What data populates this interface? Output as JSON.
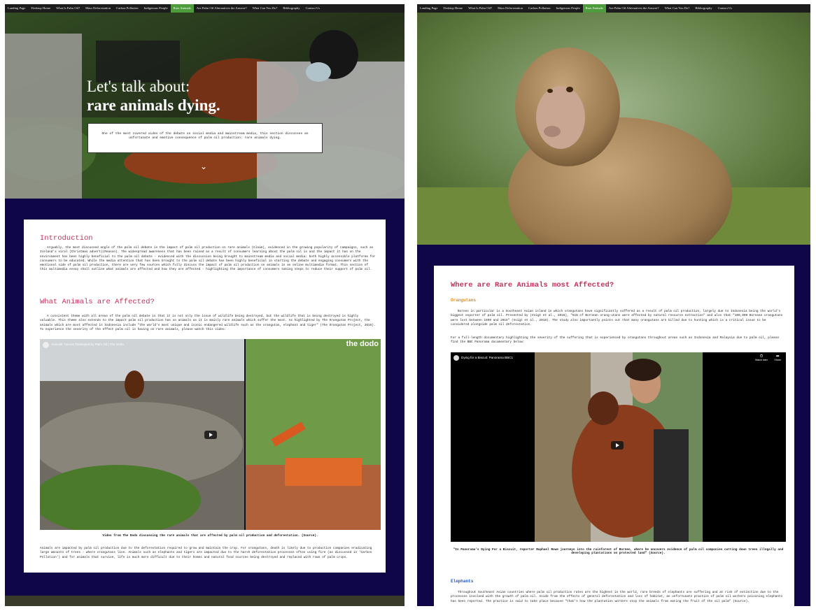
{
  "nav": {
    "items": [
      "Landing Page",
      "Desktop Home",
      "What Is Palm Oil?",
      "Mass Deforestation",
      "Carbon Pollution",
      "Indigenous People",
      "Rare Animals",
      "Are Palm Oil Alternatives the Answer?",
      "What Can You Do?",
      "Bibliography",
      "Contact Us"
    ],
    "active_index": 6
  },
  "left": {
    "hero_title_line1": "Let's talk about:",
    "hero_title_line2": "rare animals dying.",
    "hero_text": "One of the most covered sides of the debate on social media and mainstream media, this section discusses an unfortunate and emotive consequence of palm oil production: rare animals dying.",
    "intro_heading": "Introduction",
    "intro_text": "Arguably, the most discussed angle of the palm oil debate is the impact of palm oil production on rare animals (Glaim), evidenced in the growing popularity of campaigns, such as Iceland's viral (Christmas advert)(Reason). The widespread awareness that has been raised as a result of consumers learning about the palm oil is and the impact it has on the environment has been highly beneficial to the palm oil debate - evidenced with the discussion being brought to mainstream media and social media: both highly accessible platforms for consumers to be educated. While the media attention that has been brought to the palm oil debate has been highly beneficial in starting the debate and engaging consumers with the emotional side of palm oil production, there are very few sources which fully discuss the impact of palm oil production on animals in an online multimedia format. This section of this multimedia essay shall outline what animals are affected and how they are affected - highlighting the importance of consumers taking steps to reduce their support of palm oil.",
    "affected_heading": "What Animals are Affected?",
    "affected_text": "A consistent theme with all areas of the palm oil debate is that it is not only the issue of wildlife being destroyed, but the wildlife that is being destroyed is highly valuable. This theme also extends to the impact palm oil production has on animals as it is mainly rare animals which suffer the most. As highlighted by The Orangutan Project, the animals which are most affected in Indonesia include \"the world's most unique and iconic endangered wildlife such as the orangutan, elephant and tiger\" (The Orangutan Project, 2016). To experience the severity of the effect palm oil is having on rare animals, please watch this video:",
    "video_title": "Animals' Homes Destroyed by Palm Oil | The Dodo",
    "dodo_logo": "the dodo",
    "video_caption": "Video from The Dodo discussing the rare animals that are affected by palm oil production and deforestation. (Source).",
    "after_text": "Animals are impacted by palm oil production due to the deforestation required to grow and maintain the crop. For orangutans, death is likely due to production companies eradicating large amounts of trees - where orangutans live. Animals such as elephants and tigers are impacted due to the harsh deforestation processes often using fire (as discussed in 'Carbon Pollution') and for animals that survive, life is much more difficult due to their homes and natural food sources being destroyed and replaced with rows of palm crops."
  },
  "right": {
    "heading": "Where are Rare Animals most Affected?",
    "orangutans_heading": "Orangutans",
    "orangutans_text": "Borneo in particular is a Southeast Asian island in which orangutans have significantly suffered as a result of palm oil production, largely due to Indonesia being the world's biggest exporter of palm oil. Presented by (Voigt et al., 2018), \"51% of Bornean orang-utans were affected by natural resource extraction\" and also that \"100,000 Bornean orangutans were lost between 1999 and 2015\" (Voigt et al., 2018). The study also importantly points out that many orangutans are killed due to hunting which is a critical issue to be considered alongside palm oil deforestation.",
    "doc_intro": "For a full-length documentary highlighting the severity of the suffering that is experienced by orangutans throughout areas such as Indonesia and Malaysia due to palm oil, please find the BBC Panorama documentary below:",
    "video_title": "Dying for a Biscuit: Panorama BBC1",
    "watch_later": "Watch later",
    "share": "Share",
    "video_caption": "\"In Panorama's Dying For a Biscuit, reporter Raphael Rowe journeys into the rainforest of Borneo, where he uncovers evidence of palm oil companies cutting down trees illegally and developing plantations on protected land\" (Source).",
    "elephants_heading": "Elephants",
    "elephants_text": "Throughout Southeast Asian countries where palm oil production rates are the highest in the world, rare breeds of elephants are suffering and at risk of extinction due to the processes involved with the growth of palm oil. Aside from the effects of general deforestation and loss of habitat, an unfortunate practice of palm oil workers poisoning elephants has been reported. The practice is said to take place because \"that's how the plantation workers stop the animals from eating the fruit of the oil palm\" (Source)."
  },
  "colors": {
    "background": "#0e0646",
    "heading": "#c2335b",
    "link": "#3a9a2a",
    "orange_heading": "#e08a1e",
    "blue_heading": "#2255cc",
    "nav_active": "#4f9c3c"
  }
}
